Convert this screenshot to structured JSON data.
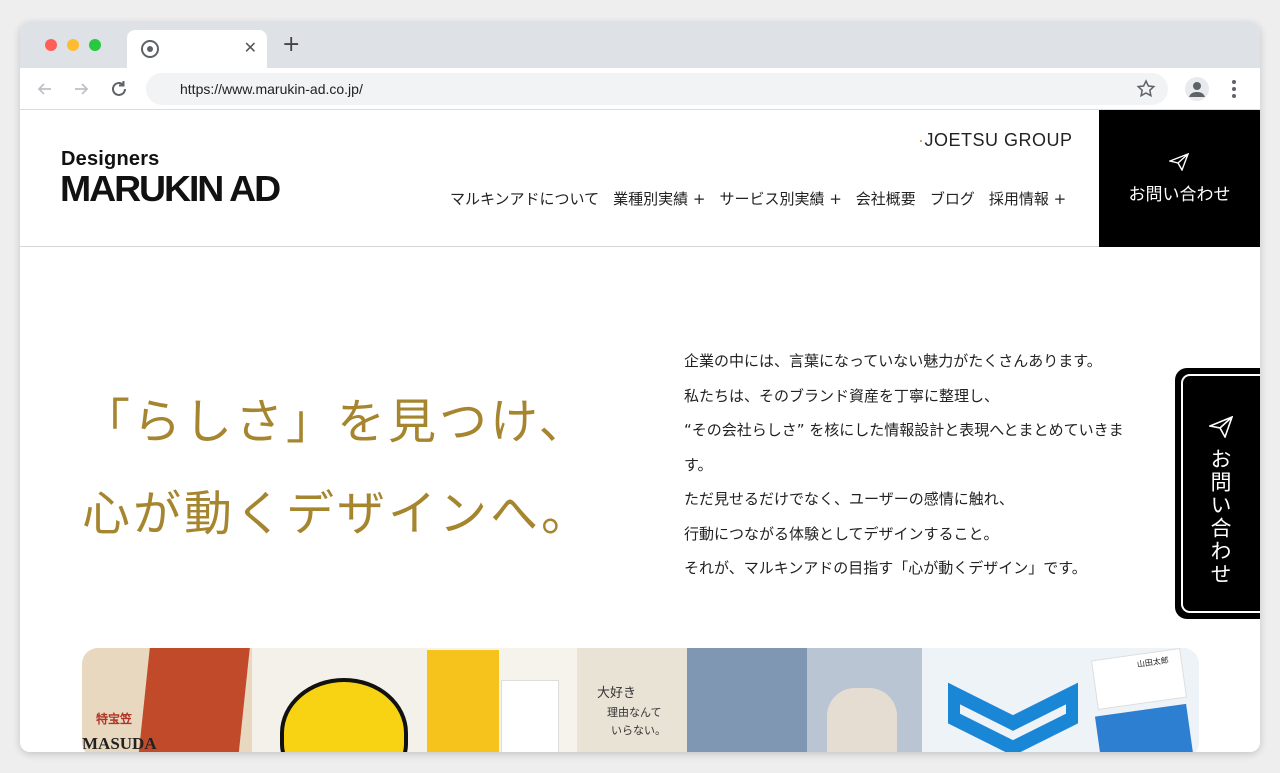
{
  "browser": {
    "tab_close": "✕",
    "new_tab": "+",
    "url": "https://www.marukin-ad.co.jp/"
  },
  "header": {
    "logo_top": "Designers",
    "logo_main": "MARUKIN AD",
    "group": "JOETSU GROUP",
    "nav": [
      {
        "label": "マルキンアドについて"
      },
      {
        "label": "業種別実績 +"
      },
      {
        "label": "サービス別実績 +"
      },
      {
        "label": "会社概要"
      },
      {
        "label": "ブログ"
      },
      {
        "label": "採用情報 +"
      }
    ],
    "cta": "お問い合わせ"
  },
  "hero": {
    "line1": "「らしさ」を見つけ、",
    "line2": "心が動くデザインへ。"
  },
  "body": {
    "lines": [
      "企業の中には、言葉になっていない魅力がたくさんあります。",
      "私たちは、そのブランド資産を丁寧に整理し、",
      "“その会社らしさ” を核にした情報設計と表現へとまとめていきま",
      "す。",
      "ただ見せるだけでなく、ユーザーの感情に触れ、",
      "行動につながる体験としてデザインすること。",
      "それが、マルキンアドの目指す「心が動くデザイン」です。"
    ]
  },
  "side_tab": {
    "label": "お問い合わせ"
  },
  "gallery": {
    "labels": [
      "特宝笠",
      "MASUDA",
      "大好き",
      "理由なんて",
      "いらない。",
      "山田太郎"
    ]
  },
  "colors": {
    "accent_gold": "#a6852f",
    "black": "#000000",
    "chrome": "#dee1e6"
  }
}
